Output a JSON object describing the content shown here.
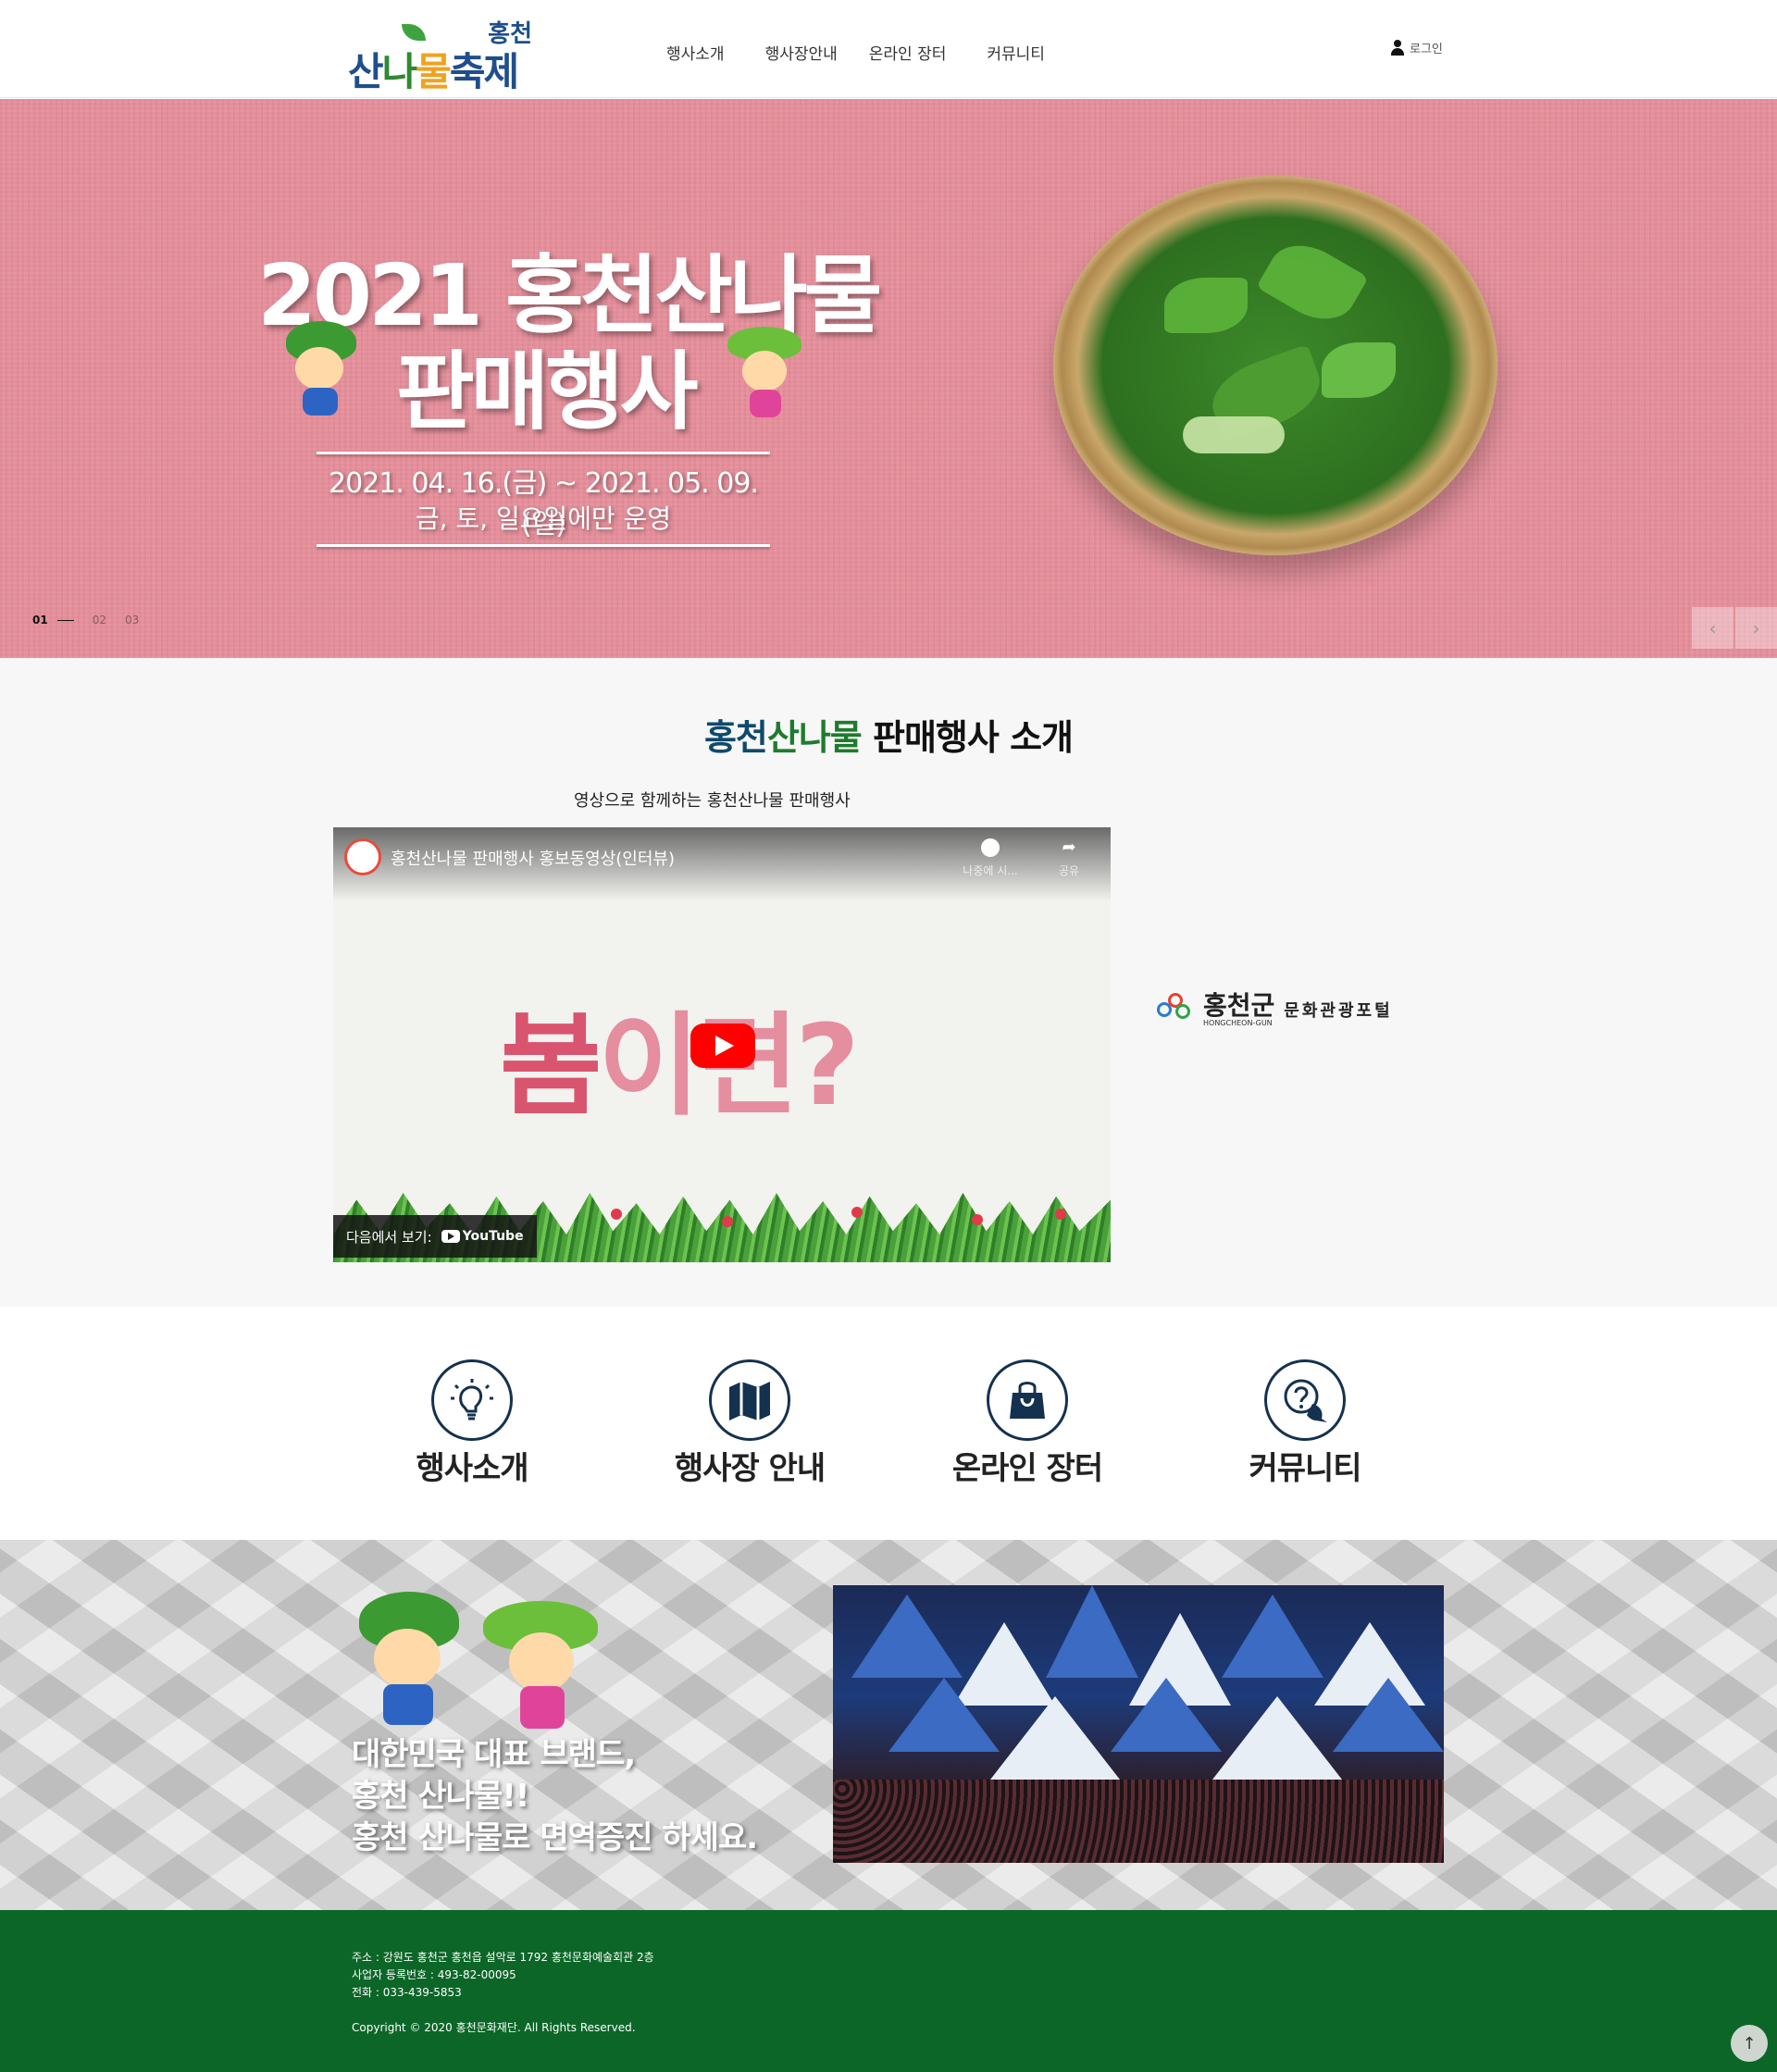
{
  "header": {
    "logo_top": "홍천",
    "logo_main": [
      "산",
      "나",
      "물",
      "축제"
    ],
    "nav": [
      "행사소개",
      "행사장안내",
      "온라인 장터",
      "커뮤니티"
    ],
    "login_label": "로그인"
  },
  "hero": {
    "title_line1": "2021 홍천산나물",
    "title_line2": "판매행사",
    "date": "2021. 04. 16.(금) ~ 2021. 05. 09.(일)",
    "note": "금, 토, 일요일에만 운영",
    "pager": [
      "01",
      "02",
      "03"
    ],
    "prev_label": "‹",
    "next_label": "›"
  },
  "intro": {
    "title_part1": "홍천",
    "title_part2": "산나물",
    "title_part3": " 판매행사 소개",
    "subtitle": "영상으로 함께하는 홍천산나물 판매행사",
    "video": {
      "title": "홍천산나물 판매행사 홍보동영상(인터뷰)",
      "later_label": "나중에 시...",
      "share_label": "공유",
      "overlay_text_1": "봄",
      "overlay_text_2": "이면?",
      "watch_on": "다음에서 보기:",
      "youtube_label": "YouTube"
    },
    "portal": {
      "name": "홍천군",
      "name_en": "HONGCHEON-GUN",
      "subtitle": "문화관광포털"
    }
  },
  "quick_links": [
    {
      "label": "행사소개",
      "icon": "lightbulb-icon"
    },
    {
      "label": "행사장 안내",
      "icon": "map-icon"
    },
    {
      "label": "온라인 장터",
      "icon": "shopping-bag-icon"
    },
    {
      "label": "커뮤니티",
      "icon": "question-chat-icon"
    }
  ],
  "brand": {
    "line1": "대한민국 대표 브랜드,",
    "line2": "홍천 산나물!!",
    "line3": "홍천 산나물로 면역증진 하세요."
  },
  "footer": {
    "address": "주소 : 강원도 홍천군 홍천읍 설악로 1792 홍천문화예술회관 2층",
    "business_no": "사업자 등록번호 : 493-82-00095",
    "phone": "전화 : 033-439-5853",
    "copyright": "Copyright © 2020 홍천문화재단. All Rights Reserved.",
    "top_label": "↑"
  },
  "colors": {
    "hero_bg": "#e58f9b",
    "footer_bg": "#0c6628",
    "accent_blue": "#0f4a6b",
    "accent_green": "#1e7b2d",
    "icon_navy": "#14314f"
  }
}
